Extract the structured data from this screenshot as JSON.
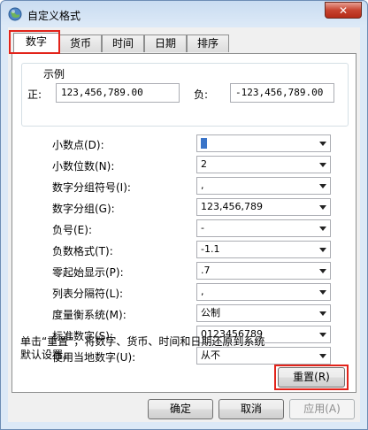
{
  "window": {
    "title": "自定义格式",
    "close_label": "✕"
  },
  "tabs": [
    {
      "label": "数字"
    },
    {
      "label": "货币"
    },
    {
      "label": "时间"
    },
    {
      "label": "日期"
    },
    {
      "label": "排序"
    }
  ],
  "sample": {
    "legend": "示例",
    "positive_label": "正:",
    "positive_value": "123,456,789.00",
    "negative_label": "负:",
    "negative_value": "-123,456,789.00"
  },
  "settings": [
    {
      "label": "小数点(D):",
      "value": ""
    },
    {
      "label": "小数位数(N):",
      "value": "2"
    },
    {
      "label": "数字分组符号(I):",
      "value": ","
    },
    {
      "label": "数字分组(G):",
      "value": "123,456,789"
    },
    {
      "label": "负号(E):",
      "value": "-"
    },
    {
      "label": "负数格式(T):",
      "value": "-1.1"
    },
    {
      "label": "零起始显示(P):",
      "value": ".7"
    },
    {
      "label": "列表分隔符(L):",
      "value": ","
    },
    {
      "label": "度量衡系统(M):",
      "value": "公制"
    },
    {
      "label": "标准数字(S):",
      "value": "0123456789"
    },
    {
      "label": "使用当地数字(U):",
      "value": "从不"
    }
  ],
  "note": "单击“重置”，将数字、货币、时间和日期还原到系统默认设置。",
  "buttons": {
    "reset": "重置(R)",
    "ok": "确定",
    "cancel": "取消",
    "apply": "应用(A)"
  },
  "colors": {
    "highlight": "#e2231a",
    "focus": "#3a74c8"
  }
}
